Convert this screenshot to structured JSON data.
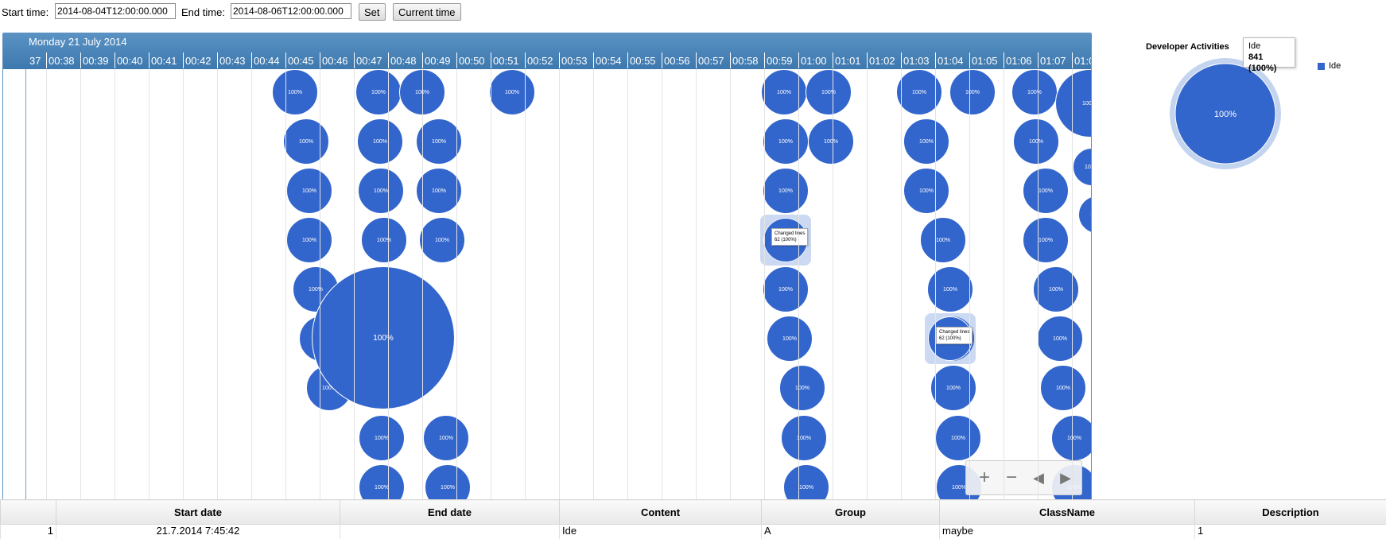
{
  "controls": {
    "start_label": "Start time:",
    "start_value": "2014-08-04T12:00:00.000",
    "end_label": "End time:",
    "end_value": "2014-08-06T12:00:00.000",
    "set_label": "Set",
    "current_time_label": "Current time"
  },
  "timeline": {
    "date_label": "Monday 21 July 2014",
    "ticks": [
      "37",
      "00:38",
      "00:39",
      "00:40",
      "00:41",
      "00:42",
      "00:43",
      "00:44",
      "00:45",
      "00:46",
      "00:47",
      "00:48",
      "00:49",
      "00:50",
      "00:51",
      "00:52",
      "00:53",
      "00:54",
      "00:55",
      "00:56",
      "00:57",
      "00:58",
      "00:59",
      "01:00",
      "01:01",
      "01:02",
      "01:03",
      "01:04",
      "01:05",
      "01:06",
      "01:07",
      "01:0"
    ],
    "bubble_label": "100%",
    "tooltip_line1": "Changed lines",
    "tooltip_line2": "62 (100%)",
    "nav": {
      "zoom_in_icon": "plus-icon",
      "zoom_out_icon": "minus-icon",
      "left_icon": "arrow-left-icon",
      "right_icon": "arrow-right-icon"
    }
  },
  "pie": {
    "title": "Developer Activities",
    "slice_label": "100%",
    "legend": "Ide",
    "tooltip_name": "Ide",
    "tooltip_value": "841 (100%)",
    "color": "#3366cc"
  },
  "grid": {
    "columns": [
      "",
      "Start date",
      "End date",
      "Content",
      "Group",
      "ClassName",
      "Description"
    ],
    "rows": [
      [
        "1",
        "21.7.2014 7:45:42",
        "",
        "Ide",
        "A",
        "maybe",
        "1"
      ]
    ]
  }
}
